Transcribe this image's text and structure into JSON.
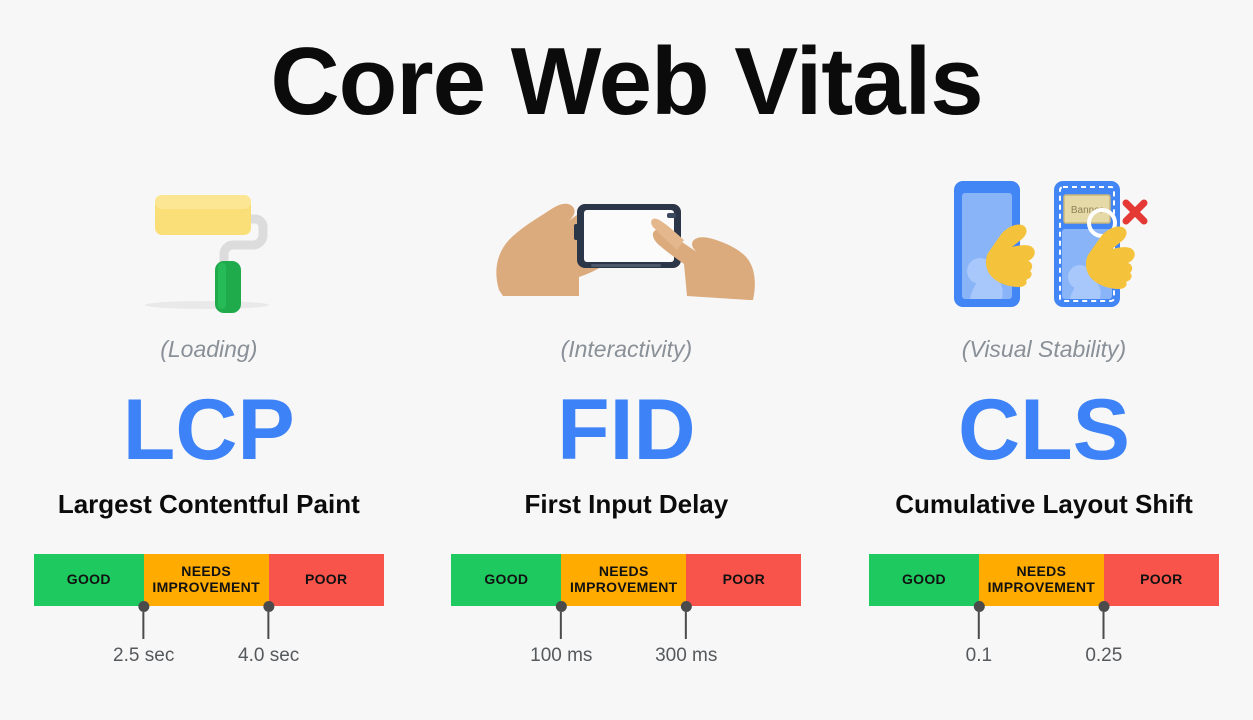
{
  "page": {
    "title": "Core Web Vitals",
    "background_color": "#f7f7f7",
    "accent_color": "#3d82f7"
  },
  "legend": {
    "good_color": "#1ec95f",
    "needs_color": "#ffab00",
    "poor_color": "#f9544b",
    "good_label": "GOOD",
    "needs_label_line1": "NEEDS",
    "needs_label_line2": "IMPROVEMENT",
    "poor_label": "POOR"
  },
  "metrics": [
    {
      "icon": "paint-roller-icon",
      "category": "(Loading)",
      "acronym": "LCP",
      "name": "Largest Contentful Paint",
      "thresholds": {
        "good_max": "2.5 sec",
        "needs_max": "4.0 sec"
      },
      "segments": [
        {
          "label": "GOOD",
          "color": "#1ec95f",
          "width_pct": 31.4
        },
        {
          "label": "NEEDS IMPROVEMENT",
          "color": "#ffab00",
          "width_pct": 35.7
        },
        {
          "label": "POOR",
          "color": "#f9544b",
          "width_pct": 32.9
        }
      ]
    },
    {
      "icon": "hands-tapping-phone-icon",
      "category": "(Interactivity)",
      "acronym": "FID",
      "name": "First Input Delay",
      "thresholds": {
        "good_max": "100 ms",
        "needs_max": "300 ms"
      },
      "segments": [
        {
          "label": "GOOD",
          "color": "#1ec95f",
          "width_pct": 31.4
        },
        {
          "label": "NEEDS IMPROVEMENT",
          "color": "#ffab00",
          "width_pct": 35.7
        },
        {
          "label": "POOR",
          "color": "#f9544b",
          "width_pct": 32.9
        }
      ]
    },
    {
      "icon": "layout-shift-phones-icon",
      "category": "(Visual Stability)",
      "acronym": "CLS",
      "name": "Cumulative Layout Shift",
      "thresholds": {
        "good_max": "0.1",
        "needs_max": "0.25"
      },
      "segments": [
        {
          "label": "GOOD",
          "color": "#1ec95f",
          "width_pct": 31.4
        },
        {
          "label": "NEEDS IMPROVEMENT",
          "color": "#ffab00",
          "width_pct": 35.7
        },
        {
          "label": "POOR",
          "color": "#f9544b",
          "width_pct": 32.9
        }
      ]
    }
  ],
  "icon_details": {
    "banner_label": "Banner"
  }
}
